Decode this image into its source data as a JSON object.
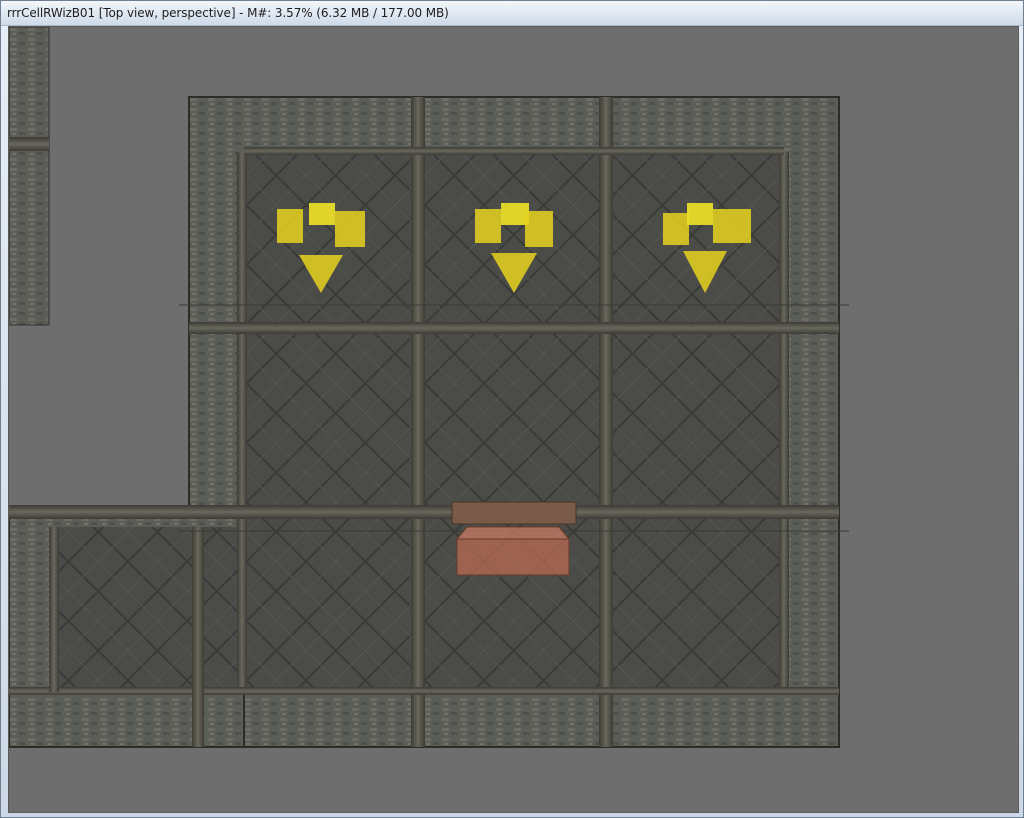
{
  "window": {
    "title": "rrrCellRWizB01 [Top view, perspective] - M#: 3.57% (6.32 MB / 177.00 MB)"
  },
  "viewport": {
    "background_color": "#6e6e6e",
    "floor_color": "#4a4b47",
    "wall_color": "#5c5d57",
    "marker_color": "#e6d21e",
    "container_color": "#b86b52",
    "objects": [
      {
        "name": "light-marker",
        "icon": "yellow-arrow-down-icon"
      },
      {
        "name": "light-marker",
        "icon": "yellow-arrow-down-icon"
      },
      {
        "name": "light-marker",
        "icon": "yellow-arrow-down-icon"
      },
      {
        "name": "chest",
        "icon": "chest-icon"
      }
    ]
  }
}
